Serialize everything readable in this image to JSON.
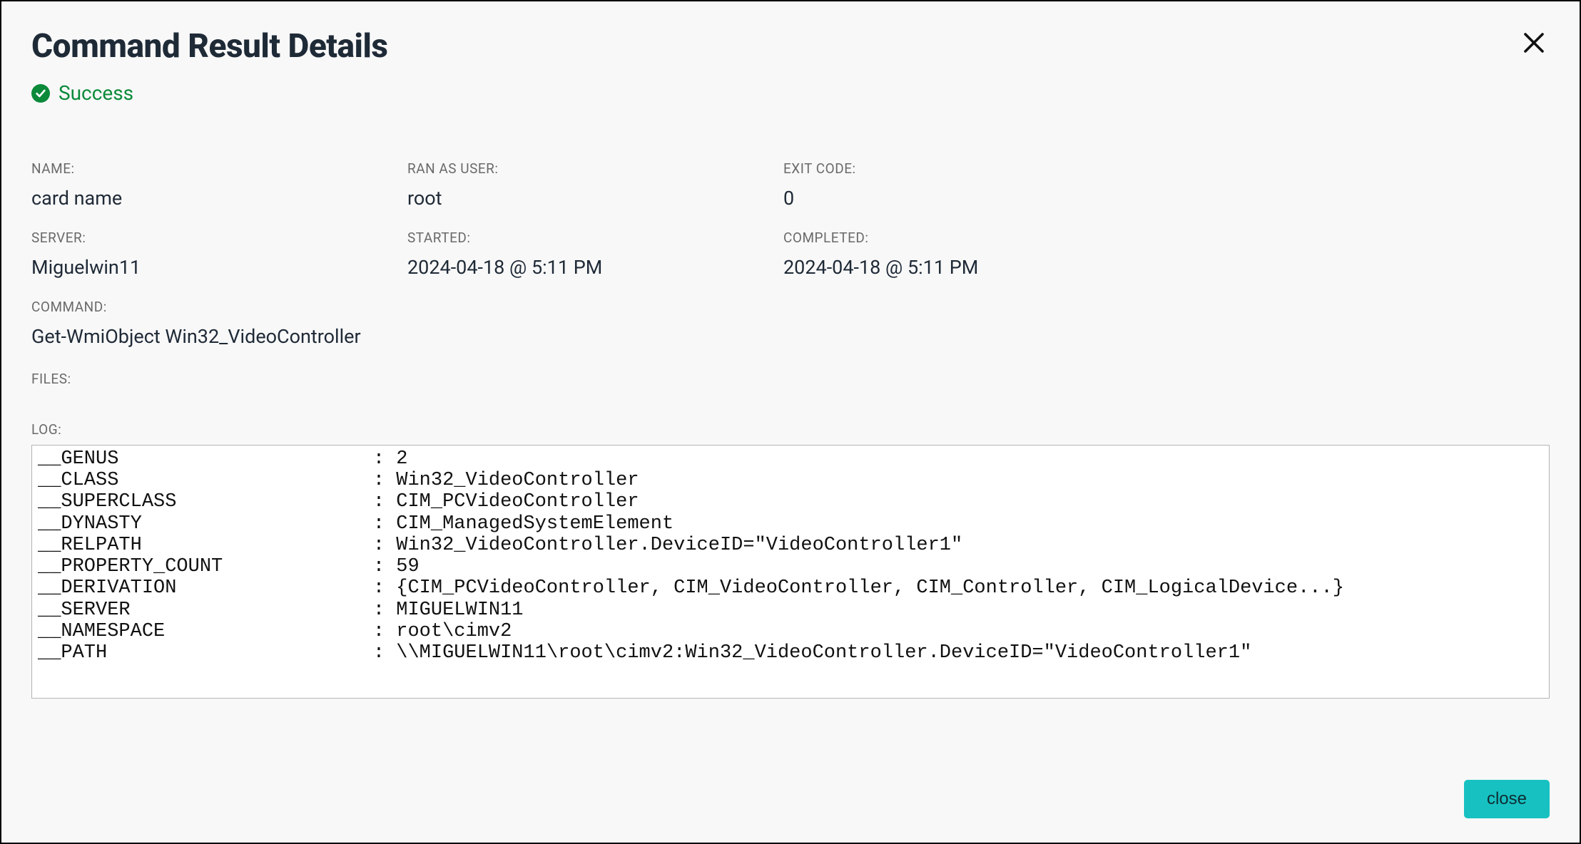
{
  "header": {
    "title": "Command Result Details"
  },
  "status": {
    "label": "Success"
  },
  "fields": {
    "name_label": "NAME:",
    "name_value": "card name",
    "ran_as_label": "RAN AS USER:",
    "ran_as_value": "root",
    "exit_code_label": "EXIT CODE:",
    "exit_code_value": "0",
    "server_label": "SERVER:",
    "server_value": "Miguelwin11",
    "started_label": "STARTED:",
    "started_value": "2024-04-18 @ 5:11 PM",
    "completed_label": "COMPLETED:",
    "completed_value": "2024-04-18 @ 5:11 PM",
    "command_label": "COMMAND:",
    "command_value": "Get-WmiObject Win32_VideoController",
    "files_label": "FILES:",
    "log_label": "LOG:"
  },
  "log": "__GENUS                      : 2\n__CLASS                      : Win32_VideoController\n__SUPERCLASS                 : CIM_PCVideoController\n__DYNASTY                    : CIM_ManagedSystemElement\n__RELPATH                    : Win32_VideoController.DeviceID=\"VideoController1\"\n__PROPERTY_COUNT             : 59\n__DERIVATION                 : {CIM_PCVideoController, CIM_VideoController, CIM_Controller, CIM_LogicalDevice...}\n__SERVER                     : MIGUELWIN11\n__NAMESPACE                  : root\\cimv2\n__PATH                       : \\\\MIGUELWIN11\\root\\cimv2:Win32_VideoController.DeviceID=\"VideoController1\"",
  "buttons": {
    "close": "close"
  },
  "colors": {
    "success": "#0b8a3a",
    "accent": "#17c1c1"
  }
}
